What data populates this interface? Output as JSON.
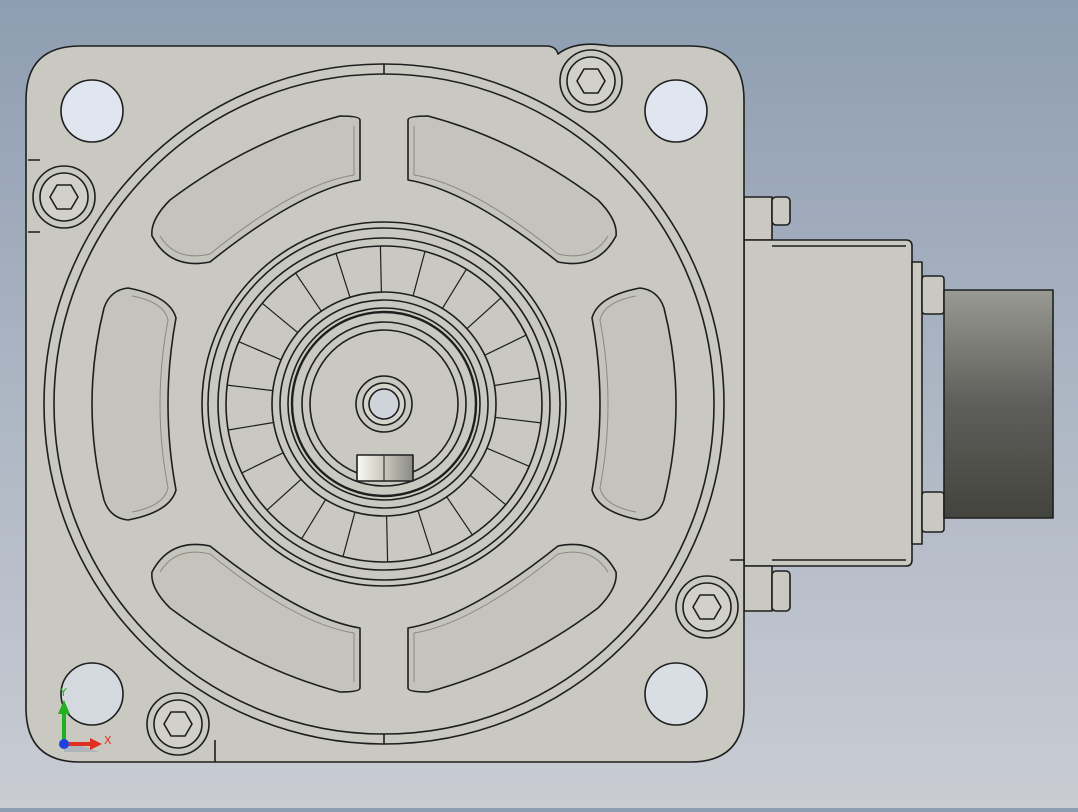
{
  "view": {
    "background_top": "#8e9db1",
    "background_bottom": "#c9ccd3",
    "part_color": "#c9c9c1",
    "edge_color": "#1e1e1e",
    "connector_color": "#6a6a66"
  },
  "triad": {
    "x_label": "X",
    "y_label": "Y",
    "x_color": "#e03020",
    "y_color": "#20b020",
    "z_color": "#2040e0"
  },
  "parts": {
    "flange": "square-mounting-flange",
    "rotor": "encoder-disc",
    "shaft": "center-shaft-bore",
    "connector": "side-connector-housing"
  }
}
